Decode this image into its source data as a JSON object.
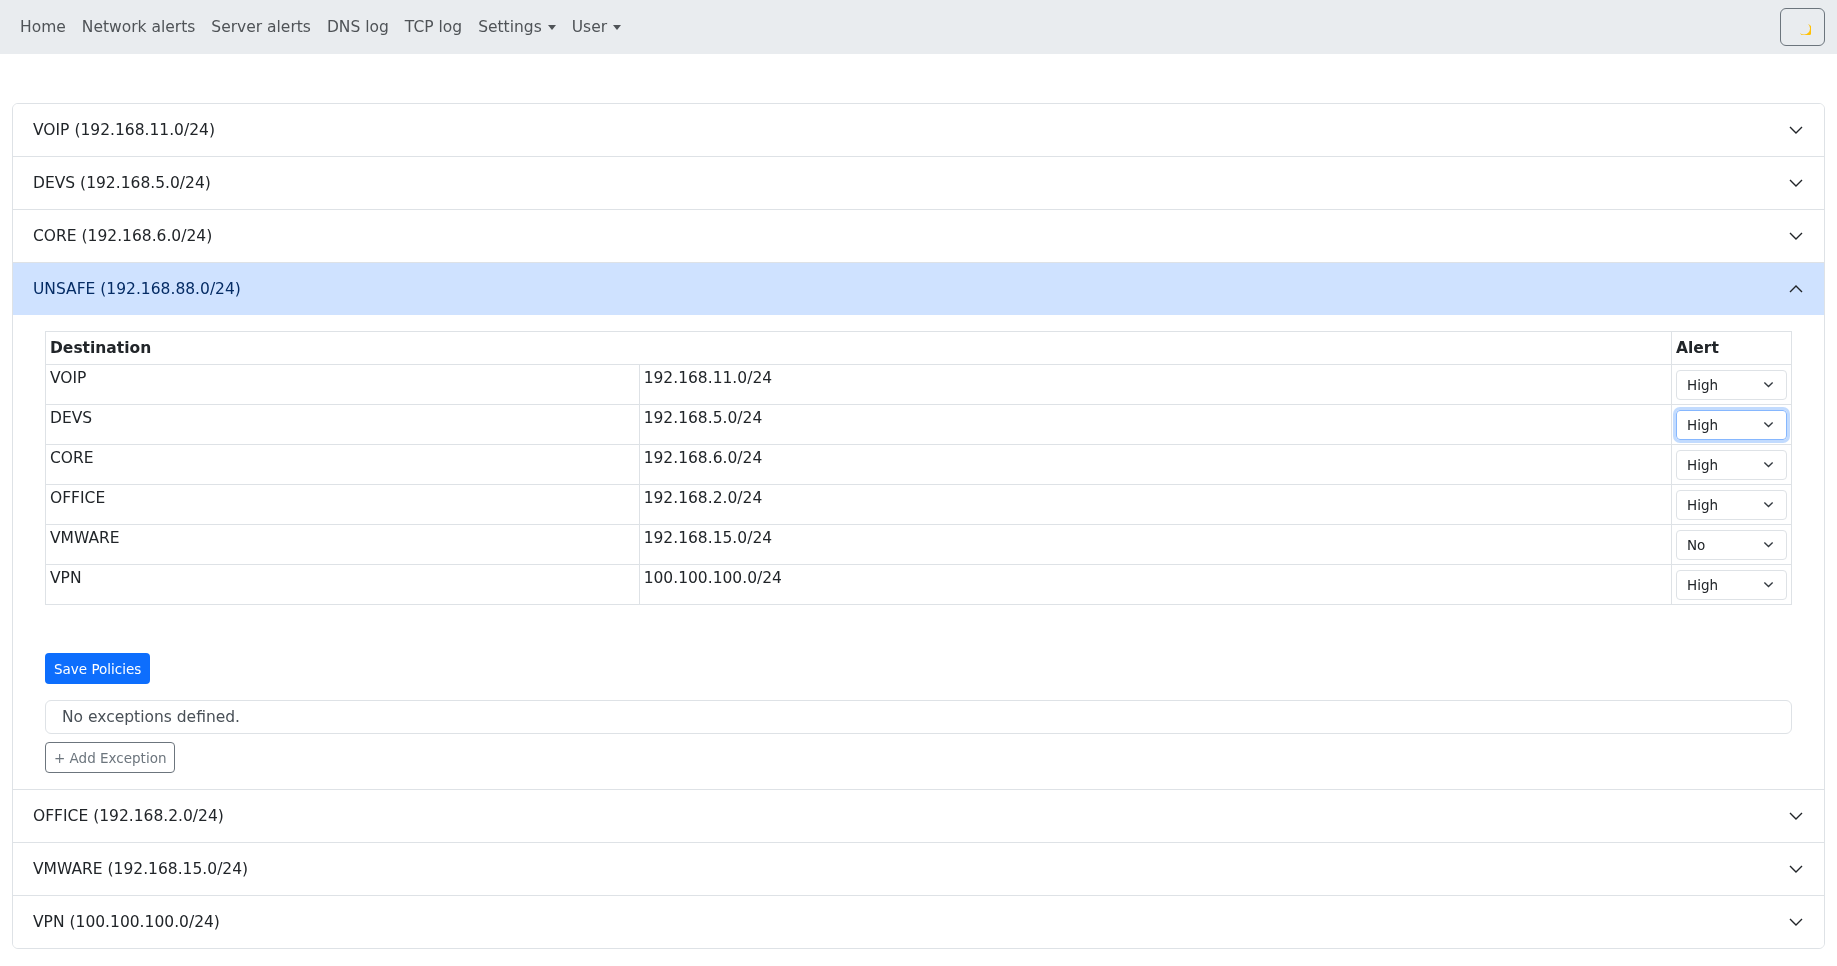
{
  "navbar": {
    "items": [
      {
        "label": "Home",
        "dropdown": false
      },
      {
        "label": "Network alerts",
        "dropdown": false
      },
      {
        "label": "Server alerts",
        "dropdown": false
      },
      {
        "label": "DNS log",
        "dropdown": false
      },
      {
        "label": "TCP log",
        "dropdown": false
      },
      {
        "label": "Settings",
        "dropdown": true
      },
      {
        "label": "User",
        "dropdown": true
      }
    ]
  },
  "networks": [
    {
      "title": "VOIP (192.168.11.0/24)",
      "expanded": false
    },
    {
      "title": "DEVS (192.168.5.0/24)",
      "expanded": false
    },
    {
      "title": "CORE (192.168.6.0/24)",
      "expanded": false
    },
    {
      "title": "UNSAFE (192.168.88.0/24)",
      "expanded": true,
      "table": {
        "columns": [
          "Destination",
          "Alert"
        ],
        "rows": [
          {
            "name": "VOIP",
            "subnet": "192.168.11.0/24",
            "alert": "High",
            "focused": false
          },
          {
            "name": "DEVS",
            "subnet": "192.168.5.0/24",
            "alert": "High",
            "focused": true
          },
          {
            "name": "CORE",
            "subnet": "192.168.6.0/24",
            "alert": "High",
            "focused": false
          },
          {
            "name": "OFFICE",
            "subnet": "192.168.2.0/24",
            "alert": "High",
            "focused": false
          },
          {
            "name": "VMWARE",
            "subnet": "192.168.15.0/24",
            "alert": "No",
            "focused": false
          },
          {
            "name": "VPN",
            "subnet": "100.100.100.0/24",
            "alert": "High",
            "focused": false
          }
        ]
      },
      "save_button": "Save Policies",
      "exceptions_text": "No exceptions defined.",
      "add_button": "+ Add Exception"
    },
    {
      "title": "OFFICE (192.168.2.0/24)",
      "expanded": false
    },
    {
      "title": "VMWARE (192.168.15.0/24)",
      "expanded": false
    },
    {
      "title": "VPN (100.100.100.0/24)",
      "expanded": false
    }
  ]
}
